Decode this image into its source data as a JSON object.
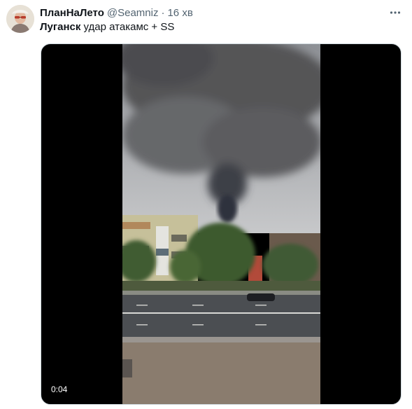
{
  "tweet": {
    "display_name": "ПланНаЛето",
    "handle": "@Seamniz",
    "separator": "·",
    "time": "16 хв",
    "text_bold": "Луганск",
    "text_rest": " удар атакамс + SS"
  },
  "media": {
    "duration": "0:04"
  },
  "icons": {
    "more": "more-horizontal-icon",
    "avatar": "avatar-image"
  }
}
